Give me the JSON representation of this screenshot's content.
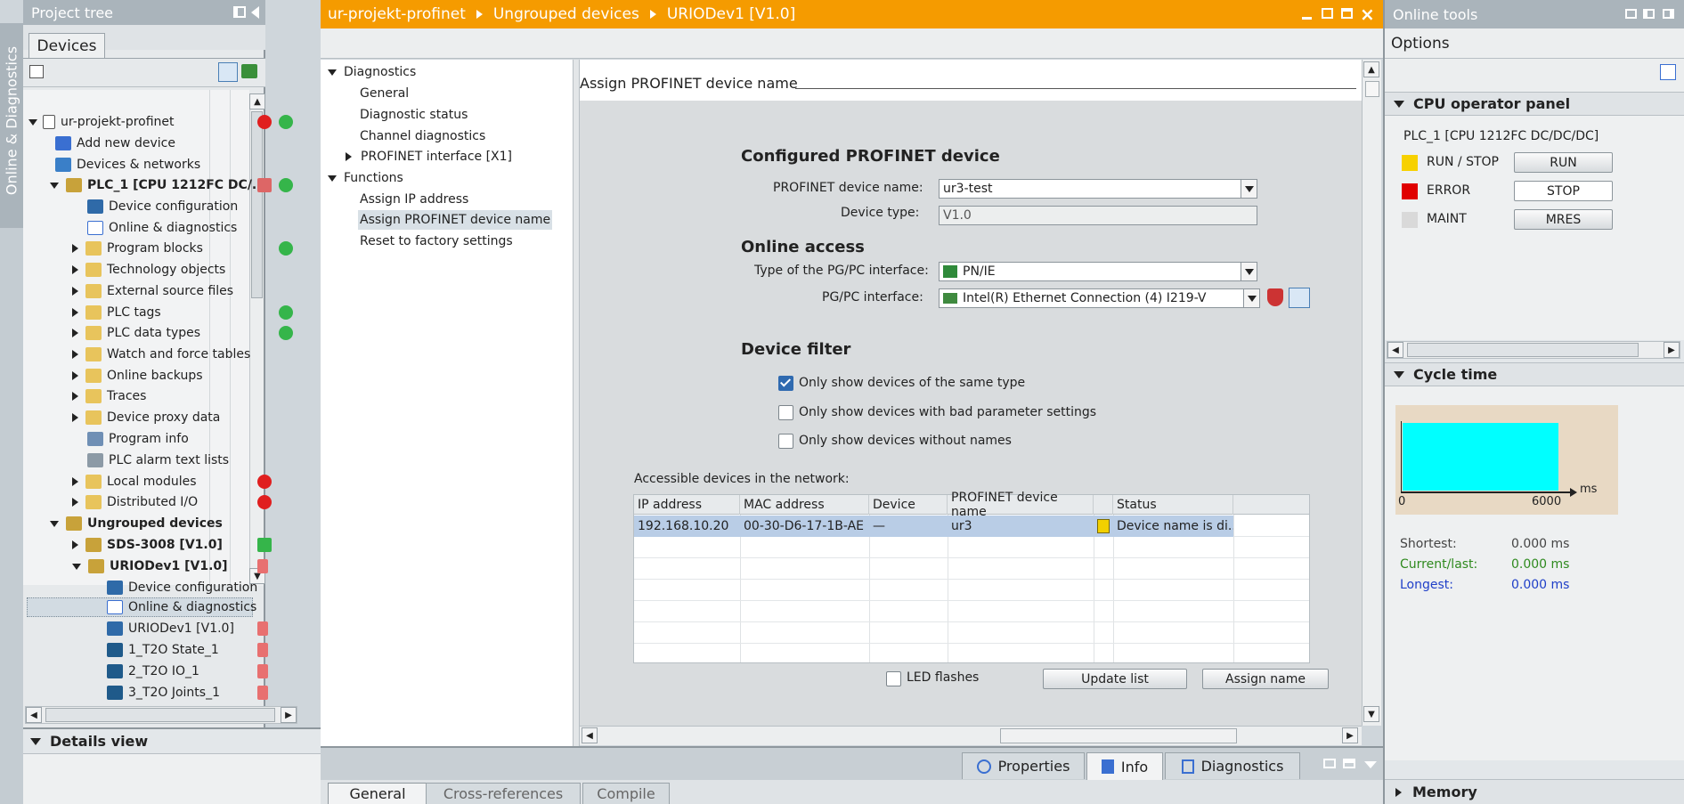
{
  "side_tab": {
    "label": "Online & Diagnostics"
  },
  "project_tree": {
    "title": "Project tree",
    "tab": "Devices",
    "items": [
      {
        "label": "ur-projekt-profinet"
      },
      {
        "label": "Add new device"
      },
      {
        "label": "Devices & networks"
      },
      {
        "label": "PLC_1 [CPU 1212FC DC/..."
      },
      {
        "label": "Device configuration"
      },
      {
        "label": "Online & diagnostics"
      },
      {
        "label": "Program blocks"
      },
      {
        "label": "Technology objects"
      },
      {
        "label": "External source files"
      },
      {
        "label": "PLC tags"
      },
      {
        "label": "PLC data types"
      },
      {
        "label": "Watch and force tables"
      },
      {
        "label": "Online backups"
      },
      {
        "label": "Traces"
      },
      {
        "label": "Device proxy data"
      },
      {
        "label": "Program info"
      },
      {
        "label": "PLC alarm text lists"
      },
      {
        "label": "Local modules"
      },
      {
        "label": "Distributed I/O"
      },
      {
        "label": "Ungrouped devices"
      },
      {
        "label": "SDS-3008 [V1.0]"
      },
      {
        "label": "URIODev1 [V1.0]"
      },
      {
        "label": "Device configuration"
      },
      {
        "label": "Online & diagnostics"
      },
      {
        "label": "URIODev1 [V1.0]"
      },
      {
        "label": "1_T2O State_1"
      },
      {
        "label": "2_T2O IO_1"
      },
      {
        "label": "3_T2O Joints_1"
      }
    ],
    "details_view": "Details view"
  },
  "editor": {
    "breadcrumb": [
      "ur-projekt-profinet",
      "Ungrouped devices",
      "URIODev1 [V1.0]"
    ],
    "nav": [
      {
        "label": "Diagnostics"
      },
      {
        "label": "General"
      },
      {
        "label": "Diagnostic status"
      },
      {
        "label": "Channel diagnostics"
      },
      {
        "label": "PROFINET interface [X1]"
      },
      {
        "label": "Functions"
      },
      {
        "label": "Assign IP address"
      },
      {
        "label": "Assign PROFINET device name"
      },
      {
        "label": "Reset to factory settings"
      }
    ],
    "section_title": "Assign PROFINET device name",
    "configured": {
      "heading": "Configured PROFINET device",
      "name_label": "PROFINET device name:",
      "name_value": "ur3-test",
      "type_label": "Device type:",
      "type_value": "V1.0"
    },
    "online": {
      "heading": "Online access",
      "iface_type_label": "Type of the PG/PC interface:",
      "iface_type_value": "PN/IE",
      "iface_label": "PG/PC interface:",
      "iface_value": "Intel(R) Ethernet Connection (4) I219-V"
    },
    "filter": {
      "heading": "Device filter",
      "opt1": "Only show devices of the same type",
      "opt2": "Only show devices with bad parameter settings",
      "opt3": "Only show devices without names"
    },
    "table": {
      "caption": "Accessible devices in the network:",
      "headers": [
        "IP address",
        "MAC address",
        "Device",
        "PROFINET device name",
        "Status"
      ],
      "row": {
        "ip": "192.168.10.20",
        "mac": "00-30-D6-17-1B-AE",
        "device": "—",
        "name": "ur3",
        "status": "Device name is di..."
      }
    },
    "led": "LED flashes",
    "update_btn": "Update list",
    "assign_btn": "Assign name"
  },
  "bottom": {
    "tabs": [
      "Properties",
      "Info",
      "Diagnostics"
    ],
    "subtabs": [
      "General",
      "Cross-references",
      "Compile"
    ]
  },
  "online_tools": {
    "title": "Online tools",
    "options": "Options",
    "cpu_panel": {
      "heading": "CPU operator panel",
      "plc": "PLC_1 [CPU 1212FC DC/DC/DC]",
      "rows": [
        {
          "label": "RUN / STOP",
          "button": "RUN",
          "color": "#f7d100"
        },
        {
          "label": "ERROR",
          "button": "STOP",
          "color": "#e00000"
        },
        {
          "label": "MAINT",
          "button": "MRES",
          "color": "#d9d9d9"
        }
      ]
    },
    "cycle": {
      "heading": "Cycle time",
      "axis_start": "0",
      "axis_end": "6000",
      "unit": "ms",
      "shortest_label": "Shortest:",
      "shortest_value": "0.000 ms",
      "current_label": "Current/last:",
      "current_value": "0.000 ms",
      "longest_label": "Longest:",
      "longest_value": "0.000 ms"
    },
    "memory": "Memory"
  }
}
